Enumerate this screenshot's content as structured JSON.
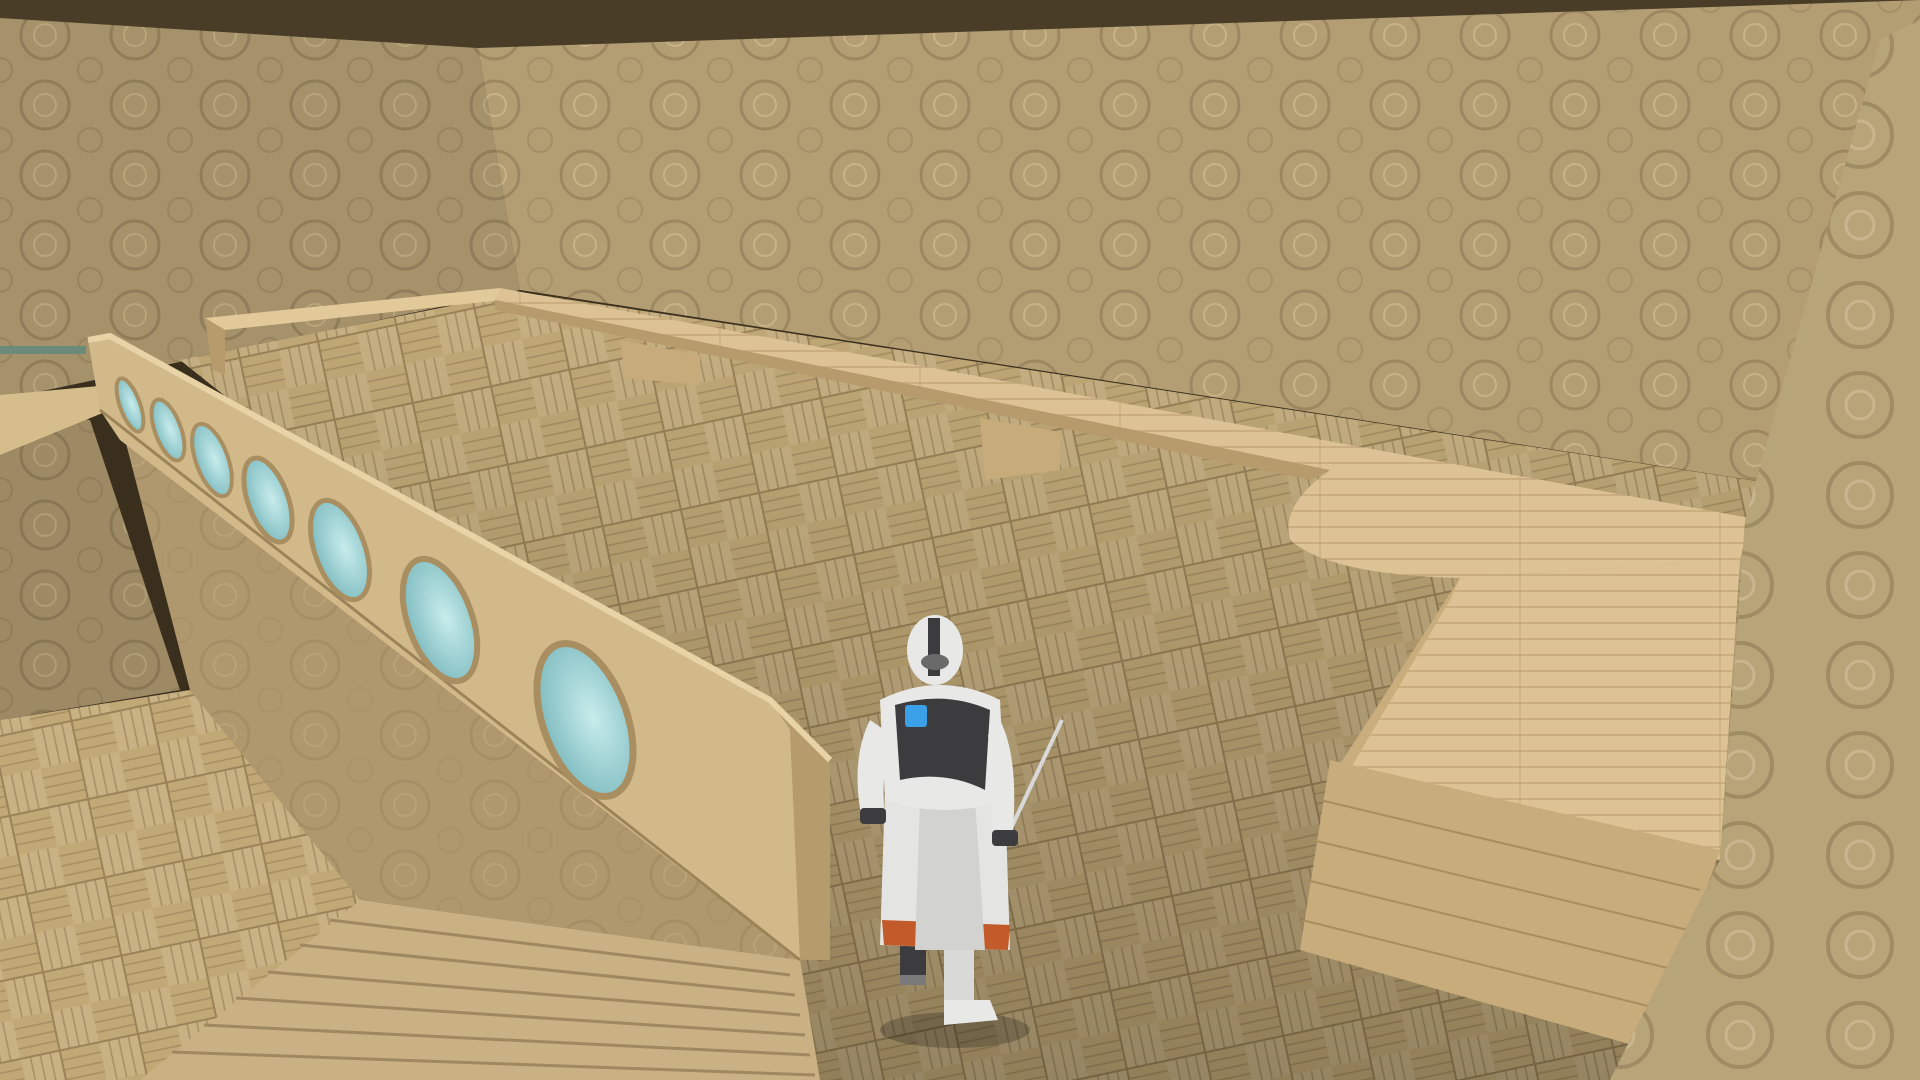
{
  "scene": {
    "kind": "third-person game view",
    "hud_visible": false,
    "colors": {
      "ceiling": "#4a3d28",
      "wall_back": "#b39e74",
      "wall_left": "#a8936b",
      "wall_right": "#c2ad80",
      "floor": "#c8b183",
      "floor_dark": "#a58e63",
      "bench": "#dcc294",
      "bench_shadow": "#b89b6c",
      "railing": "#d2b98a",
      "porthole_glass": "#9ed4d8",
      "character_armor": "#e8e8e6",
      "character_dark": "#3c3c3e",
      "character_visor": "#3aa0e8",
      "character_trim": "#c25a2a"
    },
    "objects": [
      {
        "name": "wooden-bench-ledge",
        "material": "planks"
      },
      {
        "name": "porthole-railing-wall",
        "portholes": 7
      },
      {
        "name": "staircase",
        "direction": "down"
      },
      {
        "name": "player-character",
        "weapon": "sword"
      }
    ]
  }
}
